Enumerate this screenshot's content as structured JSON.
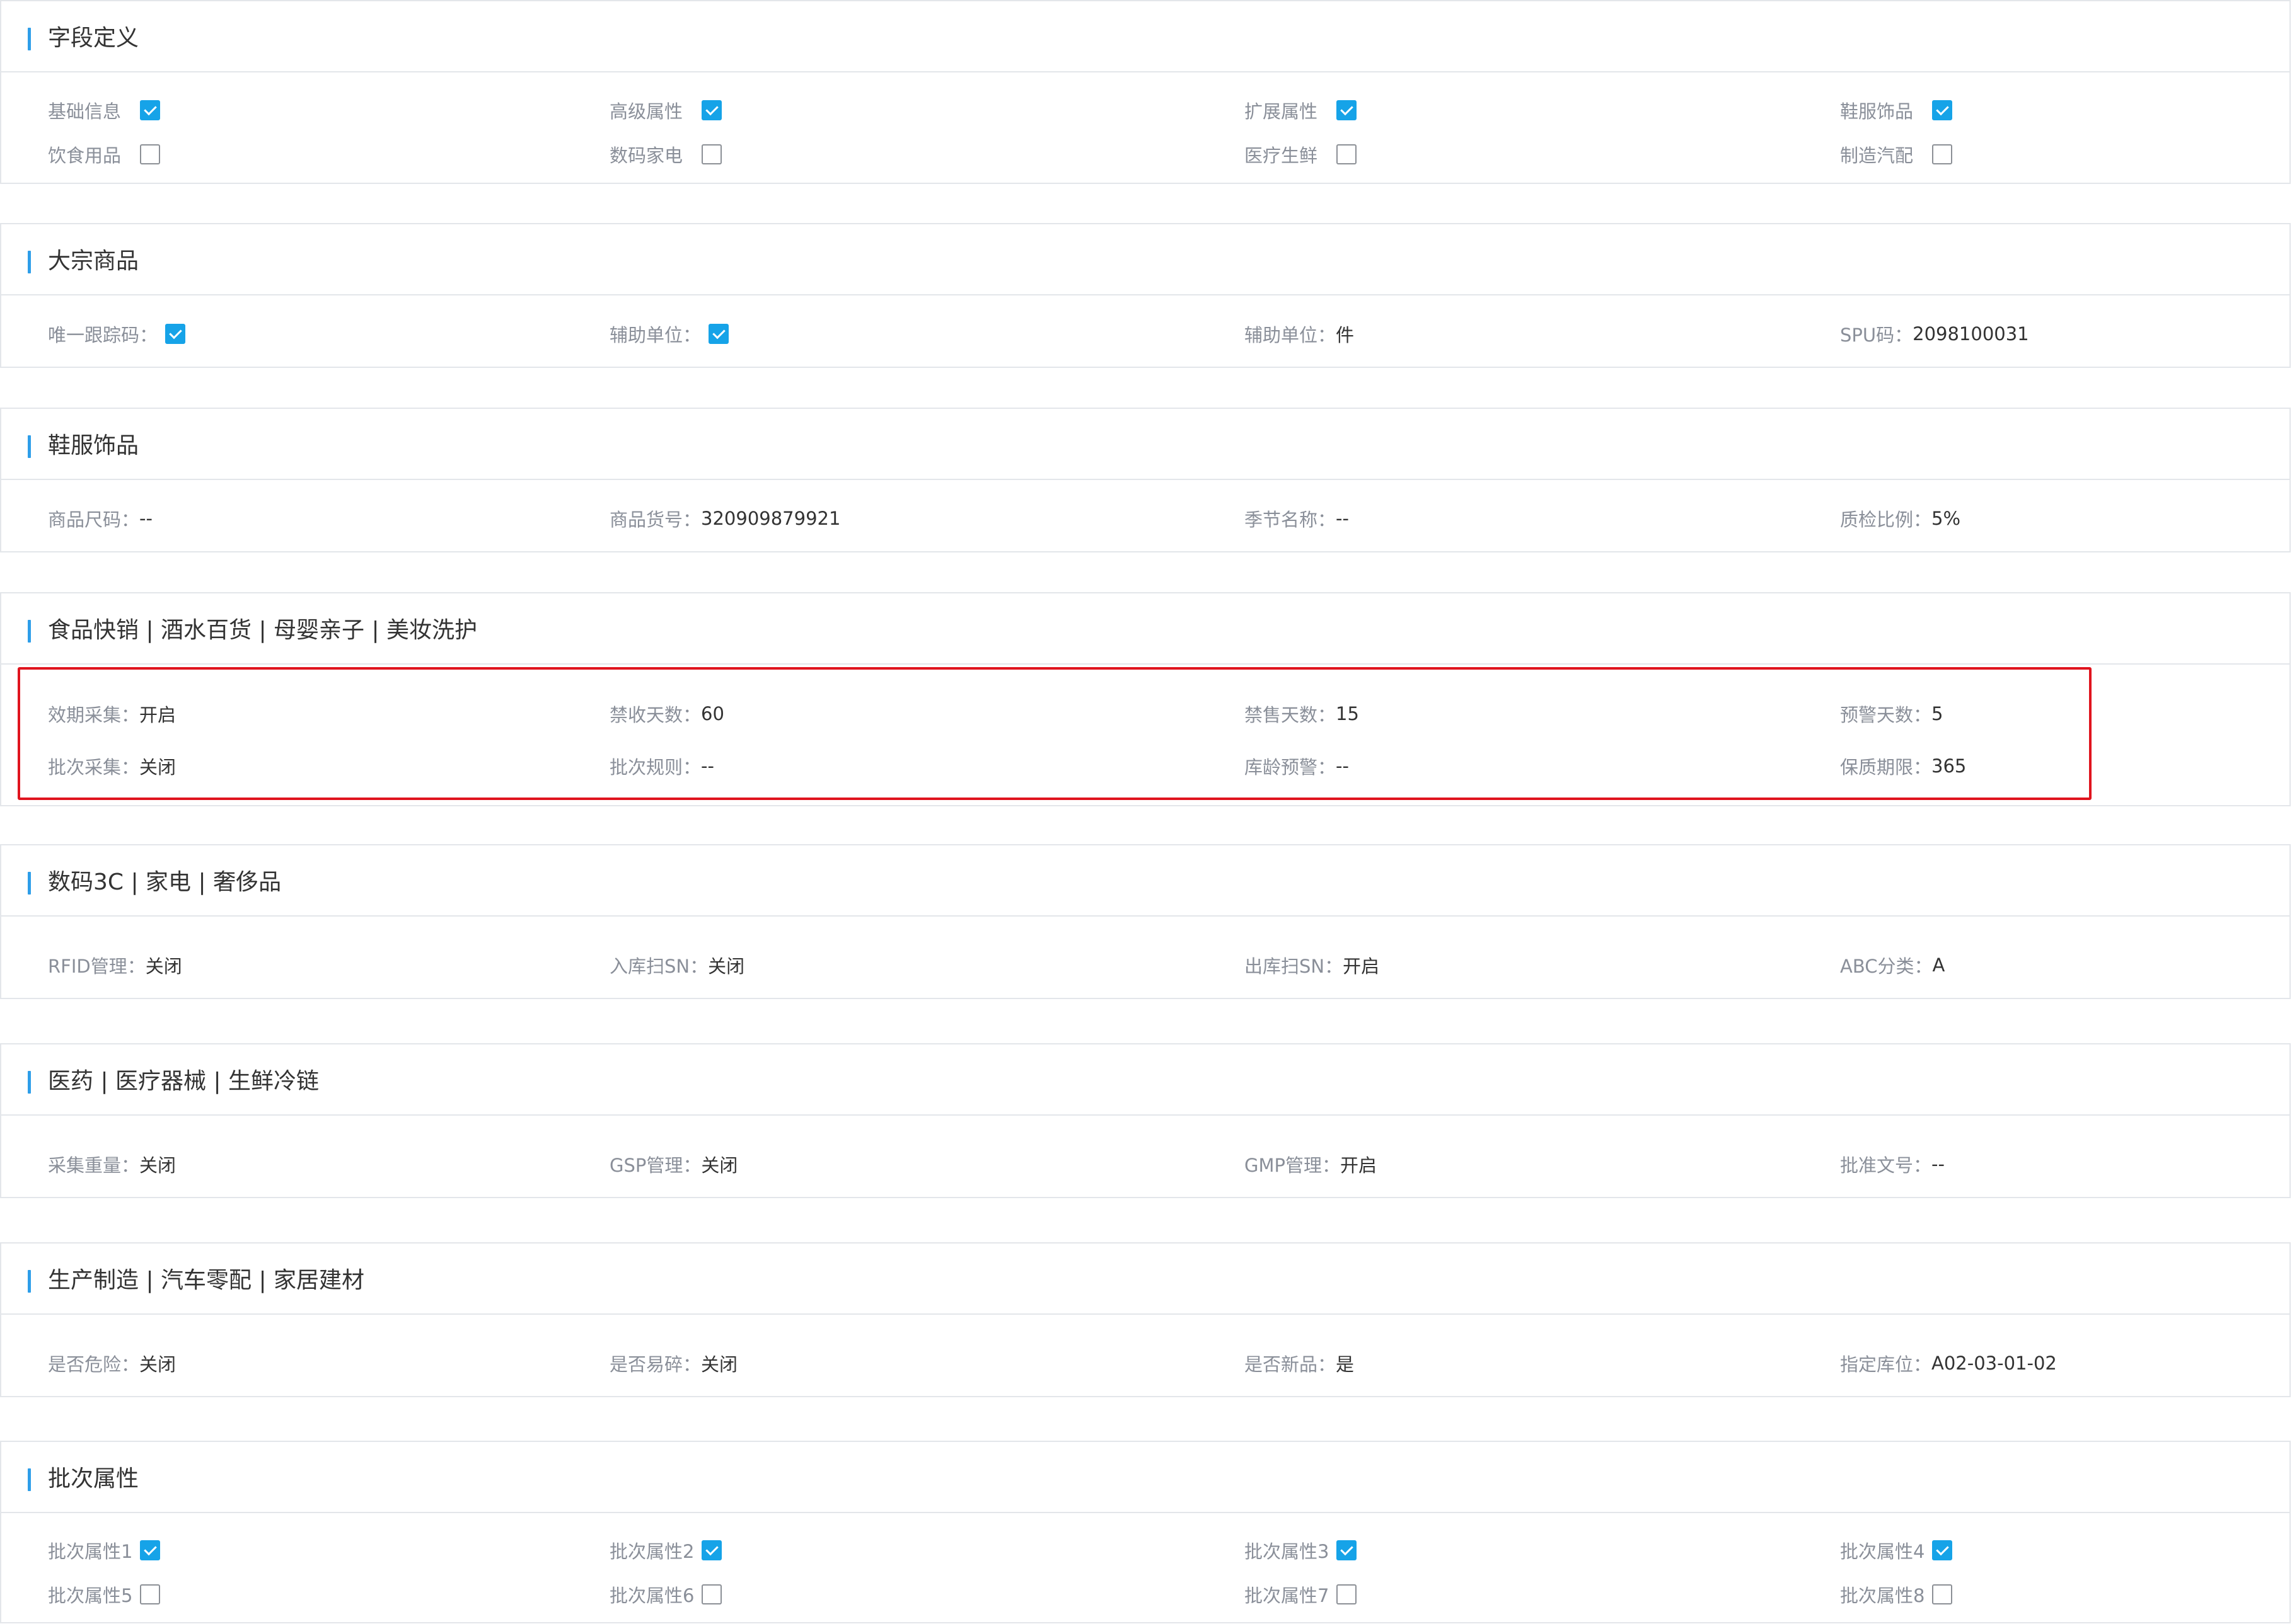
{
  "sections": {
    "field_def": {
      "title": "字段定义",
      "items": [
        {
          "label": "基础信息",
          "checked": true
        },
        {
          "label": "高级属性",
          "checked": true
        },
        {
          "label": "扩展属性",
          "checked": true
        },
        {
          "label": "鞋服饰品",
          "checked": true
        },
        {
          "label": "饮食用品",
          "checked": false
        },
        {
          "label": "数码家电",
          "checked": false
        },
        {
          "label": "医疗生鲜",
          "checked": false
        },
        {
          "label": "制造汽配",
          "checked": false
        }
      ]
    },
    "bulk": {
      "title": "大宗商品",
      "unique_tracking": {
        "label": "唯一跟踪码：",
        "checked": true
      },
      "aux_unit_check": {
        "label": "辅助单位：",
        "checked": true
      },
      "aux_unit": {
        "label": "辅助单位：",
        "value": "件"
      },
      "spu": {
        "label": "SPU码：",
        "value": "2098100031"
      }
    },
    "apparel": {
      "title": "鞋服饰品",
      "fields": [
        {
          "label": "商品尺码：",
          "value": "--"
        },
        {
          "label": "商品货号：",
          "value": "320909879921"
        },
        {
          "label": "季节名称：",
          "value": "--"
        },
        {
          "label": "质检比例：",
          "value": "5%"
        }
      ]
    },
    "food": {
      "title": "食品快销 | 酒水百货 | 母婴亲子 | 美妆洗护",
      "fields": [
        {
          "label": "效期采集：",
          "value": "开启"
        },
        {
          "label": "禁收天数：",
          "value": "60"
        },
        {
          "label": "禁售天数：",
          "value": "15"
        },
        {
          "label": "预警天数：",
          "value": "5"
        },
        {
          "label": "批次采集：",
          "value": "关闭"
        },
        {
          "label": "批次规则：",
          "value": "--"
        },
        {
          "label": "库龄预警：",
          "value": "--"
        },
        {
          "label": "保质期限：",
          "value": "365"
        }
      ]
    },
    "digital": {
      "title": "数码3C | 家电 | 奢侈品",
      "fields": [
        {
          "label": "RFID管理：",
          "value": "关闭"
        },
        {
          "label": "入库扫SN：",
          "value": "关闭"
        },
        {
          "label": "出库扫SN：",
          "value": "开启"
        },
        {
          "label": "ABC分类：",
          "value": "A"
        }
      ]
    },
    "medical": {
      "title": "医药 | 医疗器械 | 生鲜冷链",
      "fields": [
        {
          "label": "采集重量：",
          "value": "关闭"
        },
        {
          "label": "GSP管理：",
          "value": "关闭"
        },
        {
          "label": "GMP管理：",
          "value": "开启"
        },
        {
          "label": "批准文号：",
          "value": "--"
        }
      ]
    },
    "manufacturing": {
      "title": "生产制造 | 汽车零配 | 家居建材",
      "fields": [
        {
          "label": "是否危险：",
          "value": "关闭"
        },
        {
          "label": "是否易碎：",
          "value": "关闭"
        },
        {
          "label": "是否新品：",
          "value": "是"
        },
        {
          "label": "指定库位：",
          "value": "A02-03-01-02"
        }
      ]
    },
    "batch": {
      "title": "批次属性",
      "items": [
        {
          "label": "批次属性1",
          "checked": true
        },
        {
          "label": "批次属性2",
          "checked": true
        },
        {
          "label": "批次属性3",
          "checked": true
        },
        {
          "label": "批次属性4",
          "checked": true
        },
        {
          "label": "批次属性5",
          "checked": false
        },
        {
          "label": "批次属性6",
          "checked": false
        },
        {
          "label": "批次属性7",
          "checked": false
        },
        {
          "label": "批次属性8",
          "checked": false
        }
      ]
    }
  },
  "colors": {
    "accent": "#2e9ee9",
    "checkbox_checked": "#16a3e8",
    "highlight_border": "#e0141e",
    "label": "#8a8f99",
    "value": "#333333",
    "divider": "#e3e6ea"
  }
}
